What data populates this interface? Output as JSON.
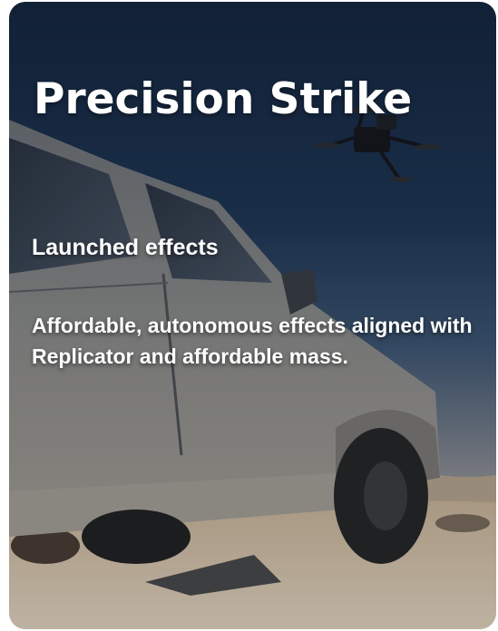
{
  "card": {
    "title": "Precision Strike",
    "subtitle": "Launched effects",
    "description": "Affordable, autonomous effects aligned with Replicator and affordable mass."
  },
  "background": {
    "sky_color": "#1a2e48",
    "sand_color": "#d5c3a9",
    "vehicle_color": "#8f8f8e"
  }
}
